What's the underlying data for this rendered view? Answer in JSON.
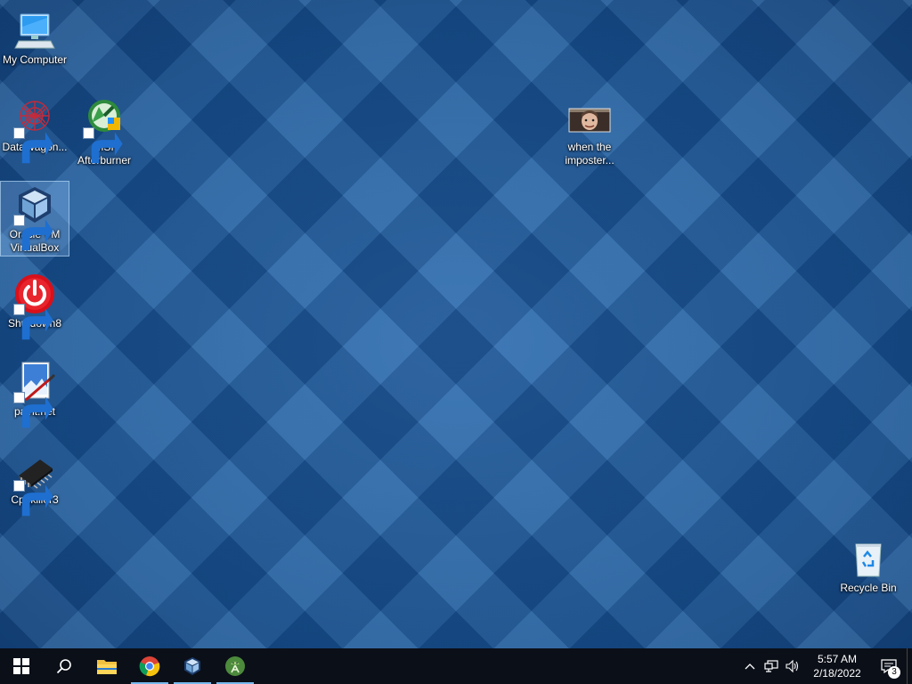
{
  "desktop": {
    "icons": {
      "my_computer": {
        "label": "My Computer",
        "icon": "computer-icon"
      },
      "datawagon": {
        "label": "DataWagon...",
        "icon": "datawagon-icon"
      },
      "msi": {
        "label": "MSI Afterburner",
        "icon": "msi-afterburner-icon"
      },
      "virtualbox": {
        "label": "Oracle VM VirtualBox",
        "icon": "virtualbox-icon",
        "selected": true
      },
      "shutdown": {
        "label": "Shutdown8",
        "icon": "power-icon"
      },
      "paintnet": {
        "label": "paint.net",
        "icon": "paintnet-icon"
      },
      "cpukiller": {
        "label": "Cpukiller3",
        "icon": "chip-icon"
      },
      "imposter": {
        "label": "when the imposter...",
        "icon": "photo-thumbnail"
      },
      "recycle_bin": {
        "label": "Recycle Bin",
        "icon": "recycle-bin-icon"
      }
    }
  },
  "taskbar": {
    "buttons": [
      "start-button",
      "search-button",
      "file-explorer",
      "chrome",
      "virtualbox",
      "android-studio"
    ],
    "clock": {
      "time": "5:57 AM",
      "date": "2/18/2022"
    },
    "notifications": {
      "count": "3"
    }
  },
  "colors": {
    "wallpaper": "#1f5e9e",
    "taskbar": "#0b0f18",
    "accent": "#76b9ed"
  }
}
